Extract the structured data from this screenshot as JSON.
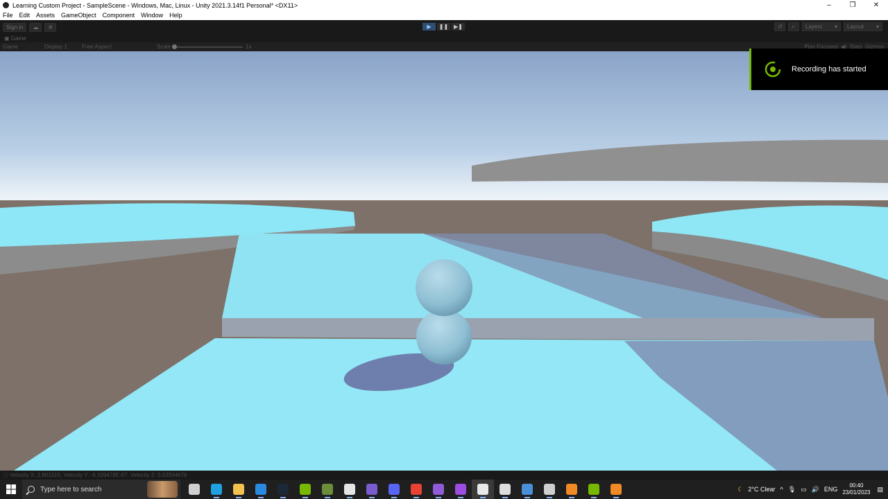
{
  "window": {
    "title": "Learning Custom Project - SampleScene - Windows, Mac, Linux - Unity 2021.3.14f1 Personal* <DX11>",
    "controls": [
      "–",
      "❐",
      "✕"
    ]
  },
  "menu": [
    "File",
    "Edit",
    "Assets",
    "GameObject",
    "Component",
    "Window",
    "Help"
  ],
  "toolbar": {
    "sign_in": "Sign in",
    "layers": "Layers",
    "layout": "Layout"
  },
  "game_tab": {
    "label": "Game"
  },
  "game_toolbar": {
    "mode": "Game",
    "display": "Display 1",
    "aspect": "Free Aspect",
    "scale_label": "Scale",
    "scale_value": "1x",
    "play_focused": "Play Focused",
    "stats": "Stats",
    "gizmos": "Gizmos"
  },
  "notification": {
    "text": "Recording has started",
    "accent": "#76b900"
  },
  "status": {
    "text": "Velocity X: 2.801515, Velocity Y: -6.109478E-07, Velocity Z: 0.02934676"
  },
  "taskbar": {
    "search_placeholder": "Type here to search",
    "weather": "2°C  Clear",
    "language": "ENG",
    "time": "00:40",
    "date": "23/01/2023"
  },
  "taskbar_apps": [
    {
      "name": "task-view-icon",
      "color": "#d0d0d0"
    },
    {
      "name": "edge-icon",
      "color": "#1fa0e0"
    },
    {
      "name": "file-explorer-icon",
      "color": "#f2c14e"
    },
    {
      "name": "mail-icon",
      "color": "#2a8ae0"
    },
    {
      "name": "steam-icon",
      "color": "#1b2838"
    },
    {
      "name": "nvidia-icon",
      "color": "#76b900"
    },
    {
      "name": "minecraft-icon",
      "color": "#6b8e3a"
    },
    {
      "name": "store-icon",
      "color": "#e6e6e6"
    },
    {
      "name": "github-desktop-icon",
      "color": "#7a5ccf"
    },
    {
      "name": "discord-icon",
      "color": "#5865f2"
    },
    {
      "name": "chrome-icon",
      "color": "#e94235"
    },
    {
      "name": "visual-studio-icon",
      "color": "#8f5bd6"
    },
    {
      "name": "app-purple-icon",
      "color": "#9a4de0"
    },
    {
      "name": "unity-hub-icon",
      "color": "#e8e8e8"
    },
    {
      "name": "unity-icon",
      "color": "#dddddd"
    },
    {
      "name": "calculator-icon",
      "color": "#4a90d9"
    },
    {
      "name": "obs-icon",
      "color": "#cfcfcf"
    },
    {
      "name": "blender-icon",
      "color": "#f08a24"
    },
    {
      "name": "geforce-icon",
      "color": "#76b900"
    },
    {
      "name": "blender-2-icon",
      "color": "#f08a24"
    }
  ]
}
